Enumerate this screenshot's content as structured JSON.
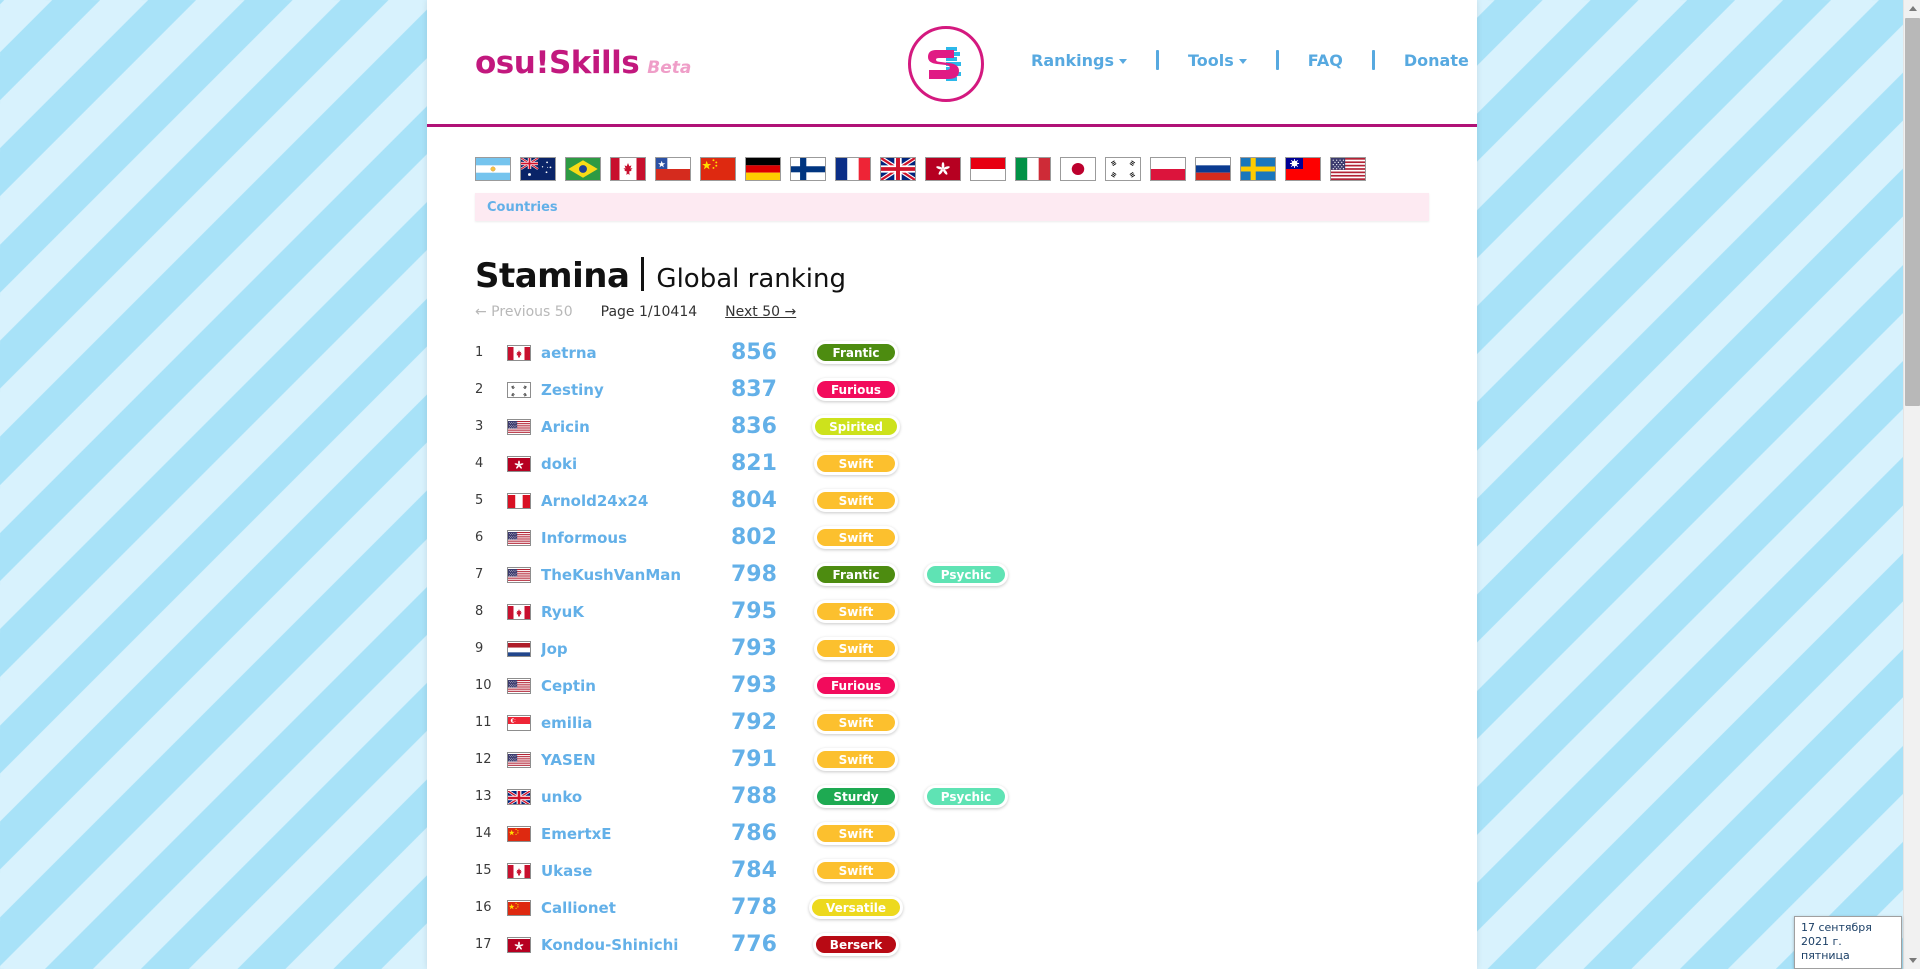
{
  "brand": {
    "name": "osu!Skills",
    "tag": "Beta",
    "logo_icon": "osu-skills-logo-icon"
  },
  "nav": {
    "items": [
      {
        "label": "Rankings",
        "has_caret": true
      },
      {
        "label": "Tools",
        "has_caret": true
      },
      {
        "label": "FAQ",
        "has_caret": false
      },
      {
        "label": "Donate",
        "has_caret": false
      }
    ]
  },
  "flags_row": {
    "items": [
      {
        "code": "AR",
        "name": "Argentina"
      },
      {
        "code": "AU",
        "name": "Australia"
      },
      {
        "code": "BR",
        "name": "Brazil"
      },
      {
        "code": "CA",
        "name": "Canada"
      },
      {
        "code": "CL",
        "name": "Chile"
      },
      {
        "code": "CN",
        "name": "China"
      },
      {
        "code": "DE",
        "name": "Germany"
      },
      {
        "code": "FI",
        "name": "Finland"
      },
      {
        "code": "FR",
        "name": "France"
      },
      {
        "code": "GB",
        "name": "United Kingdom"
      },
      {
        "code": "HK",
        "name": "Hong Kong"
      },
      {
        "code": "ID",
        "name": "Indonesia"
      },
      {
        "code": "IT",
        "name": "Italy"
      },
      {
        "code": "JP",
        "name": "Japan"
      },
      {
        "code": "KR",
        "name": "South Korea"
      },
      {
        "code": "PL",
        "name": "Poland"
      },
      {
        "code": "RU",
        "name": "Russia"
      },
      {
        "code": "SE",
        "name": "Sweden"
      },
      {
        "code": "TW",
        "name": "Taiwan"
      },
      {
        "code": "US",
        "name": "United States"
      }
    ]
  },
  "countries_bar": {
    "label": "Countries"
  },
  "ranking": {
    "skill": "Stamina",
    "scope": "Global ranking",
    "prev_label": "← Previous 50",
    "page_label": "Page 1/10414",
    "next_label": "Next 50 →",
    "rows": [
      {
        "pos": "1",
        "flag": "CA",
        "name": "aetrna",
        "score": "856",
        "badges": [
          {
            "label": "Frantic",
            "color": "#4d8c10"
          }
        ]
      },
      {
        "pos": "2",
        "flag": "KR",
        "name": "Zestiny",
        "score": "837",
        "badges": [
          {
            "label": "Furious",
            "color": "#f20b5c"
          }
        ]
      },
      {
        "pos": "3",
        "flag": "US",
        "name": "Aricin",
        "score": "836",
        "badges": [
          {
            "label": "Spirited",
            "color": "#cde21c"
          }
        ]
      },
      {
        "pos": "4",
        "flag": "HK",
        "name": "doki",
        "score": "821",
        "badges": [
          {
            "label": "Swift",
            "color": "#fcc02e"
          }
        ]
      },
      {
        "pos": "5",
        "flag": "PE",
        "name": "Arnold24x24",
        "score": "804",
        "badges": [
          {
            "label": "Swift",
            "color": "#fcc02e"
          }
        ]
      },
      {
        "pos": "6",
        "flag": "US",
        "name": "Informous",
        "score": "802",
        "badges": [
          {
            "label": "Swift",
            "color": "#fcc02e"
          }
        ]
      },
      {
        "pos": "7",
        "flag": "US",
        "name": "TheKushVanMan",
        "score": "798",
        "badges": [
          {
            "label": "Frantic",
            "color": "#4d8c10"
          },
          {
            "label": "Psychic",
            "color": "#5fe3b4"
          }
        ]
      },
      {
        "pos": "8",
        "flag": "CA",
        "name": "RyuK",
        "score": "795",
        "badges": [
          {
            "label": "Swift",
            "color": "#fcc02e"
          }
        ]
      },
      {
        "pos": "9",
        "flag": "NL",
        "name": "Jop",
        "score": "793",
        "badges": [
          {
            "label": "Swift",
            "color": "#fcc02e"
          }
        ]
      },
      {
        "pos": "10",
        "flag": "US",
        "name": "Ceptin",
        "score": "793",
        "badges": [
          {
            "label": "Furious",
            "color": "#f20b5c"
          }
        ]
      },
      {
        "pos": "11",
        "flag": "SG",
        "name": "emilia",
        "score": "792",
        "badges": [
          {
            "label": "Swift",
            "color": "#fcc02e"
          }
        ]
      },
      {
        "pos": "12",
        "flag": "US",
        "name": "YASEN",
        "score": "791",
        "badges": [
          {
            "label": "Swift",
            "color": "#fcc02e"
          }
        ]
      },
      {
        "pos": "13",
        "flag": "GB",
        "name": "unko",
        "score": "788",
        "badges": [
          {
            "label": "Sturdy",
            "color": "#1eaa52"
          },
          {
            "label": "Psychic",
            "color": "#5fe3b4"
          }
        ]
      },
      {
        "pos": "14",
        "flag": "CN",
        "name": "EmertxE",
        "score": "786",
        "badges": [
          {
            "label": "Swift",
            "color": "#fcc02e"
          }
        ]
      },
      {
        "pos": "15",
        "flag": "CA",
        "name": "Ukase",
        "score": "784",
        "badges": [
          {
            "label": "Swift",
            "color": "#fcc02e"
          }
        ]
      },
      {
        "pos": "16",
        "flag": "CN",
        "name": "Callionet",
        "score": "778",
        "badges": [
          {
            "label": "Versatile",
            "color": "#edd91e"
          }
        ]
      },
      {
        "pos": "17",
        "flag": "HK",
        "name": "Kondou-Shinichi",
        "score": "776",
        "badges": [
          {
            "label": "Berserk",
            "color": "#b80a14"
          }
        ]
      }
    ]
  },
  "date_tooltip": {
    "date": "17 сентября 2021 г.",
    "weekday": "пятница"
  },
  "theme": {
    "accent_pink": "#c2187e",
    "link_blue": "#63b0e8",
    "bar_pink": "#fdeaf2"
  }
}
